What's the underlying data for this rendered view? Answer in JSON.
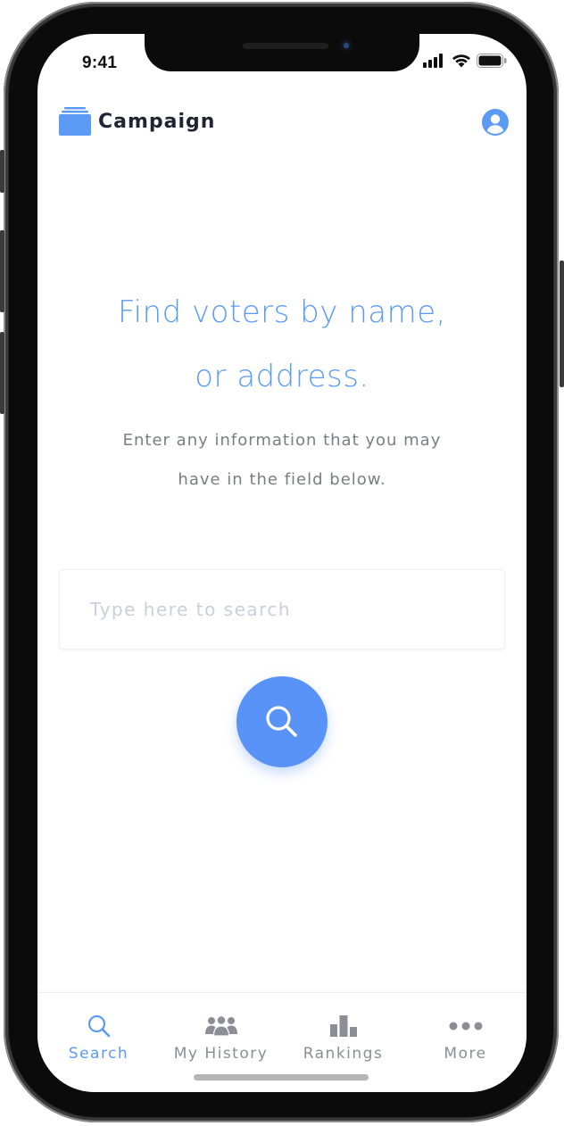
{
  "status_bar": {
    "time": "9:41",
    "icons": [
      "signal-icon",
      "wifi-icon",
      "battery-icon"
    ]
  },
  "header": {
    "app_title": "Campaign",
    "logo_icon": "folder-stack-icon",
    "account_icon": "user-circle-icon"
  },
  "hero": {
    "headline_line1": "Find voters by name,",
    "headline_line2": "or address.",
    "sub_line1": "Enter any information that you may",
    "sub_line2": "have in the field below."
  },
  "search": {
    "placeholder": "Type here to search",
    "value": "",
    "button_icon": "search-icon"
  },
  "tabbar": {
    "items": [
      {
        "label": "Search",
        "icon": "search-icon",
        "active": true
      },
      {
        "label": "My History",
        "icon": "group-icon",
        "active": false
      },
      {
        "label": "Rankings",
        "icon": "bar-chart-icon",
        "active": false
      },
      {
        "label": "More",
        "icon": "more-dots-icon",
        "active": false
      }
    ]
  },
  "colors": {
    "accent": "#5b9af5",
    "button": "#5a93f8",
    "text_dark": "#1f2433",
    "text_muted": "#7a7d85",
    "placeholder": "#c9d0db",
    "tab_inactive": "#8b8e95"
  }
}
